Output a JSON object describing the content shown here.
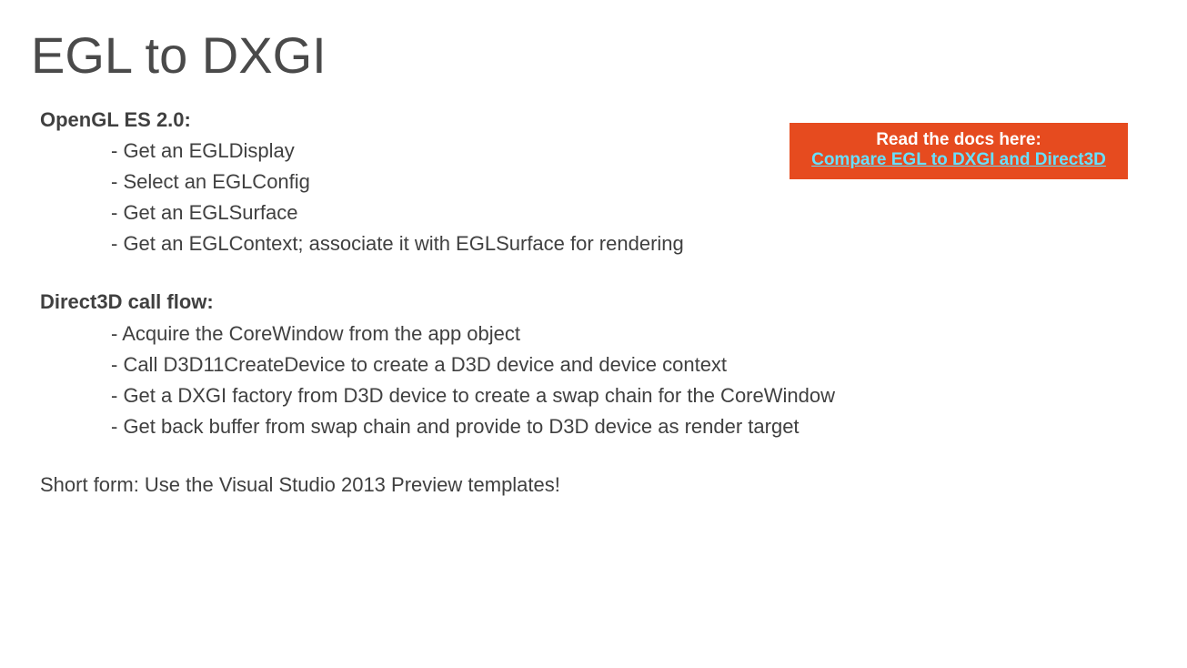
{
  "title": "EGL to DXGI",
  "section1": {
    "label": "OpenGL ES 2.0:",
    "bullets": [
      "- Get an EGLDisplay",
      "- Select an EGLConfig",
      "- Get an EGLSurface",
      "- Get an EGLContext; associate it with EGLSurface for rendering"
    ]
  },
  "section2": {
    "label": "Direct3D call flow:",
    "bullets": [
      "- Acquire the CoreWindow from the app object",
      "- Call D3D11CreateDevice to create a D3D device and device context",
      "- Get a DXGI factory from D3D device to create a swap chain for the CoreWindow",
      "- Get back buffer from swap chain and provide to D3D device as render target"
    ]
  },
  "short_form": "Short form: Use the Visual Studio 2013 Preview templates!",
  "callout": {
    "line1": "Read the docs here:",
    "line2": "Compare EGL to DXGI and Direct3D"
  }
}
